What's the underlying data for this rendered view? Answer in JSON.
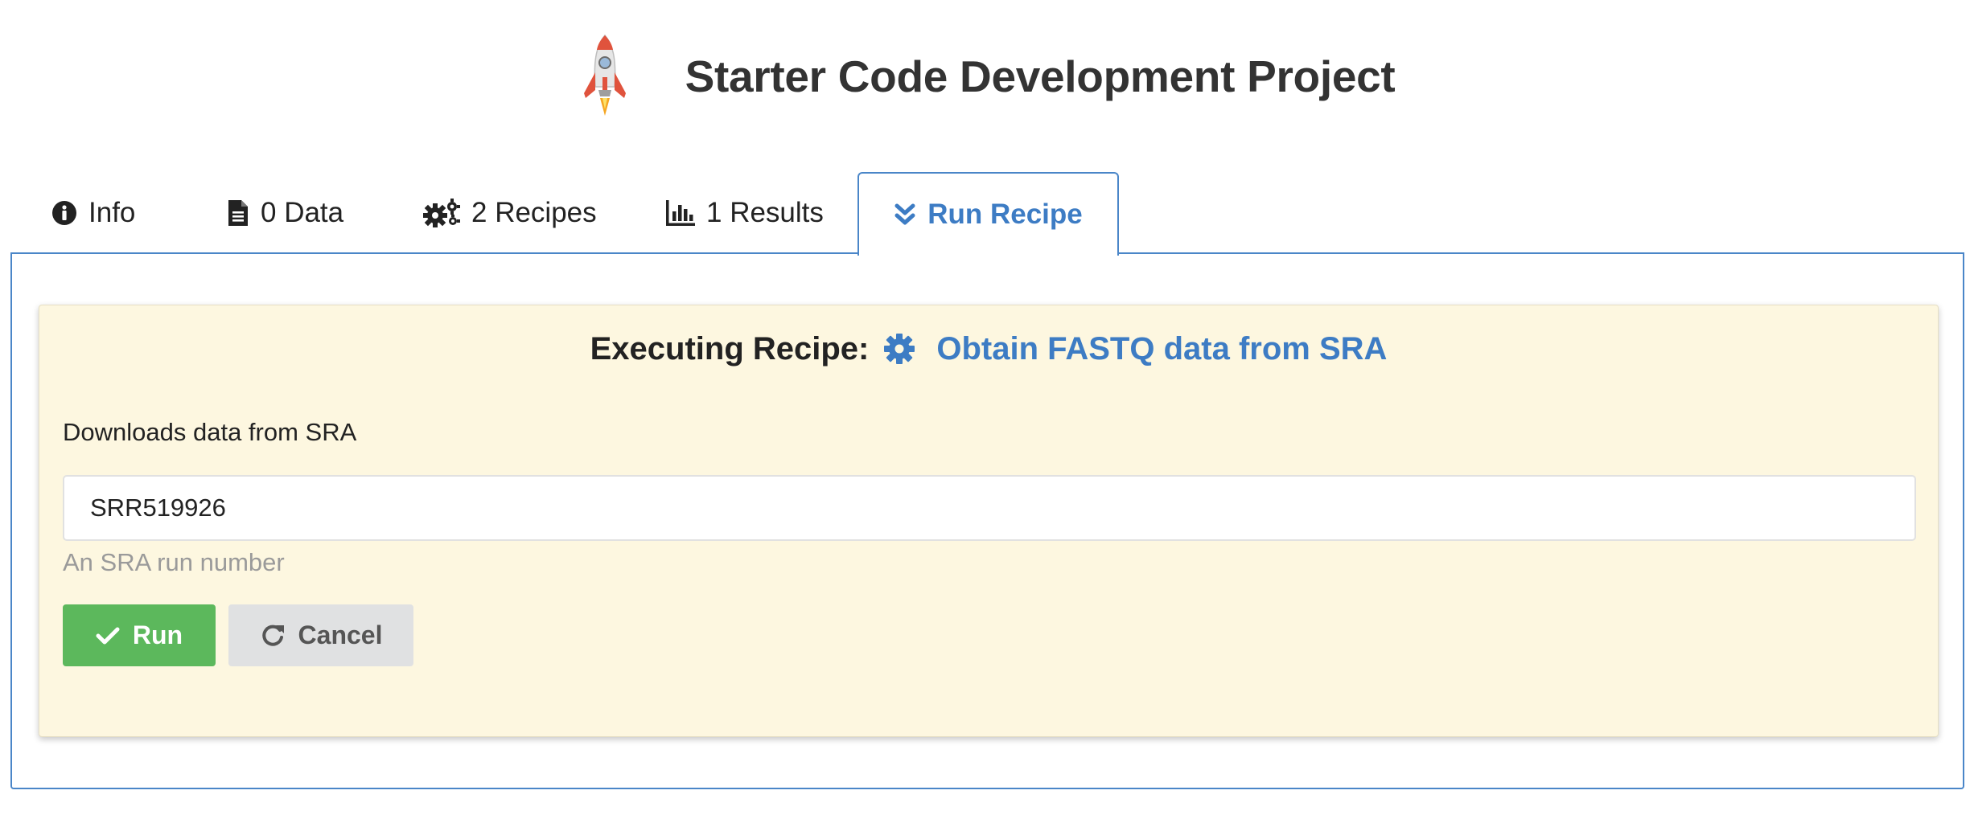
{
  "header": {
    "title": "Starter Code Development Project",
    "logo_icon": "rocket-icon"
  },
  "tabs": [
    {
      "label": "Info",
      "icon": "info-circle-icon",
      "active": false
    },
    {
      "label": "0 Data",
      "icon": "file-icon",
      "active": false
    },
    {
      "label": "2 Recipes",
      "icon": "gears-icon",
      "active": false
    },
    {
      "label": "1 Results",
      "icon": "bar-chart-icon",
      "active": false
    },
    {
      "label": "Run Recipe",
      "icon": "double-chevron-down-icon",
      "active": true
    }
  ],
  "executing": {
    "label": "Executing Recipe:",
    "icon": "gear-icon",
    "recipe_name": "Obtain FASTQ data from SRA"
  },
  "form": {
    "description": "Downloads data from SRA",
    "input_value": "SRR519926",
    "input_hint": "An SRA run number"
  },
  "buttons": {
    "run_label": "Run",
    "run_icon": "check-icon",
    "cancel_label": "Cancel",
    "cancel_icon": "redo-icon"
  },
  "colors": {
    "accent": "#3d7cc4",
    "run_green": "#5cb85c",
    "card_bg": "#fdf7e0",
    "cancel_bg": "#e0e1e2"
  }
}
